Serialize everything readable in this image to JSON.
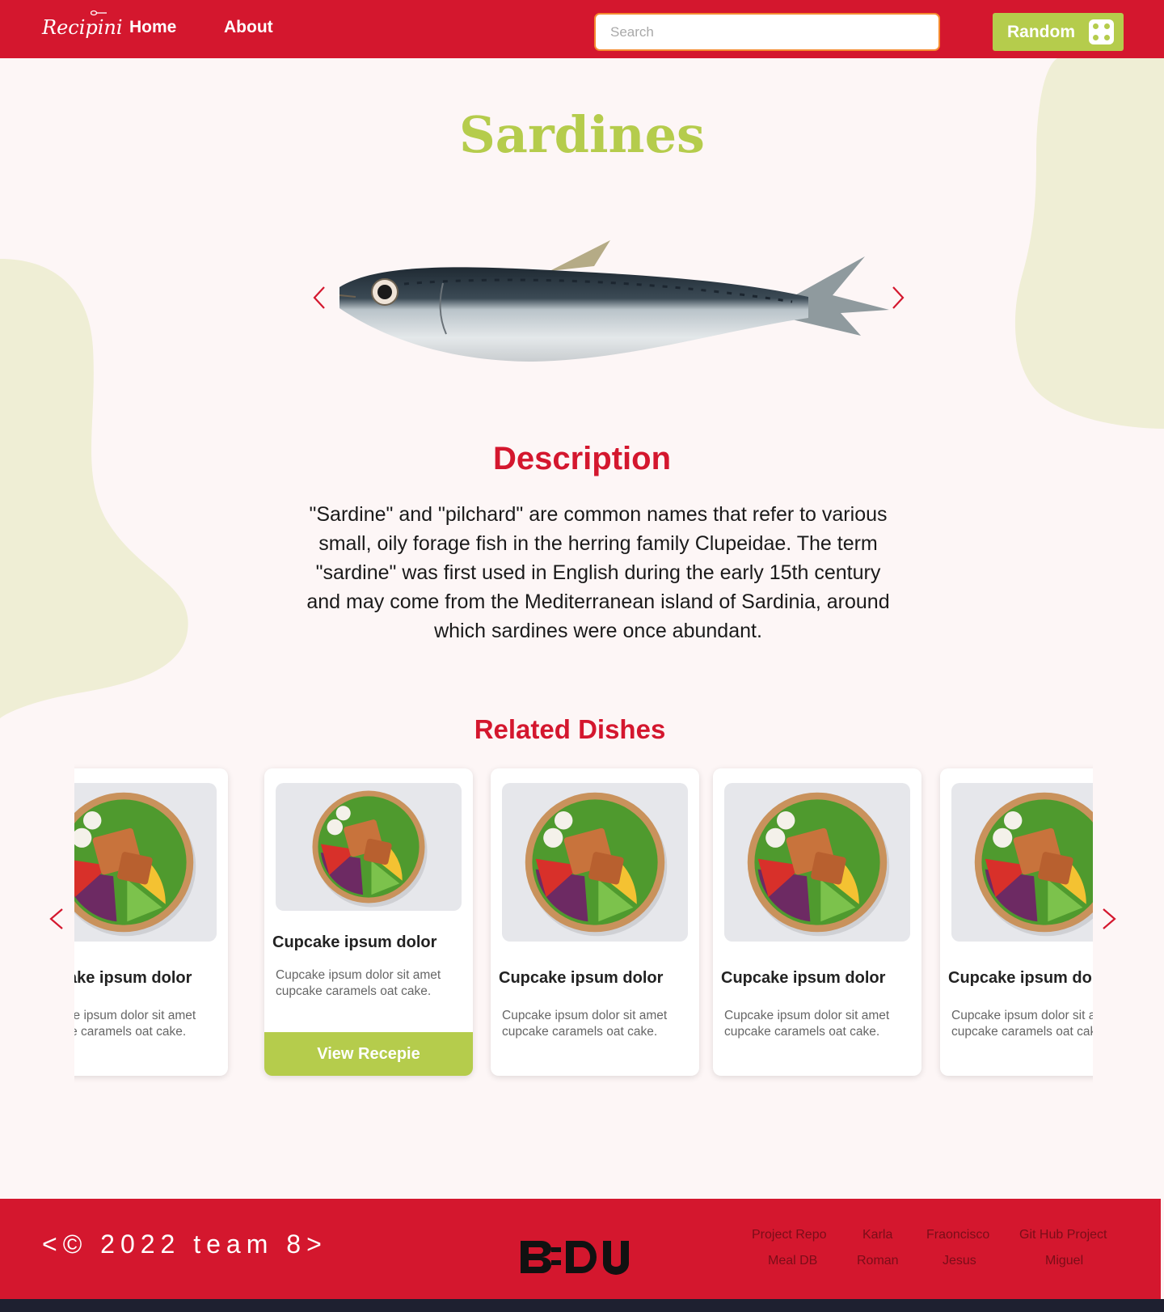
{
  "header": {
    "logo_text": "Recipini",
    "nav": [
      "Home",
      "About"
    ],
    "search_placeholder": "Search",
    "random_label": "Random"
  },
  "main": {
    "title": "Sardines",
    "description_heading": "Description",
    "description_text": "\"Sardine\" and \"pilchard\" are common names that refer to various small, oily forage fish in the herring family Clupeidae. The term \"sardine\" was first used in English during the early 15th century and may come from the Mediterranean island of Sardinia, around which sardines were once abundant.",
    "related_heading": "Related Dishes",
    "cards": [
      {
        "title": "Cupcake ipsum dolor",
        "text": "Cupcake ipsum dolor sit amet cupcake caramels oat cake."
      },
      {
        "title": "Cupcake ipsum dolor",
        "text": "Cupcake ipsum dolor sit amet cupcake caramels oat cake.",
        "button": "View Recepie"
      },
      {
        "title": "Cupcake ipsum dolor",
        "text": "Cupcake ipsum dolor sit amet cupcake caramels oat cake."
      },
      {
        "title": "Cupcake ipsum dolor",
        "text": "Cupcake ipsum dolor sit amet cupcake caramels oat cake."
      },
      {
        "title": "Cupcake ipsum dolor",
        "text": "Cupcake ipsum dolor sit amet cupcake caramels oat cake."
      }
    ]
  },
  "footer": {
    "copyright": "<© 2022 team 8>",
    "brand": "BEDU",
    "links": [
      {
        "top": "Project Repo",
        "bottom": "Meal DB"
      },
      {
        "top": "Karla",
        "bottom": "Roman"
      },
      {
        "top": "Fraoncisco",
        "bottom": "Jesus"
      },
      {
        "top": "Git Hub Project",
        "bottom": "Miguel"
      }
    ]
  },
  "colors": {
    "brand_red": "#d4172e",
    "accent_green": "#b5cc4c",
    "blob": "#efeed5",
    "background": "#fdf6f6"
  },
  "icons": [
    "dice-icon",
    "chevron-left-icon",
    "chevron-right-icon",
    "bowl-image",
    "sardine-image"
  ]
}
